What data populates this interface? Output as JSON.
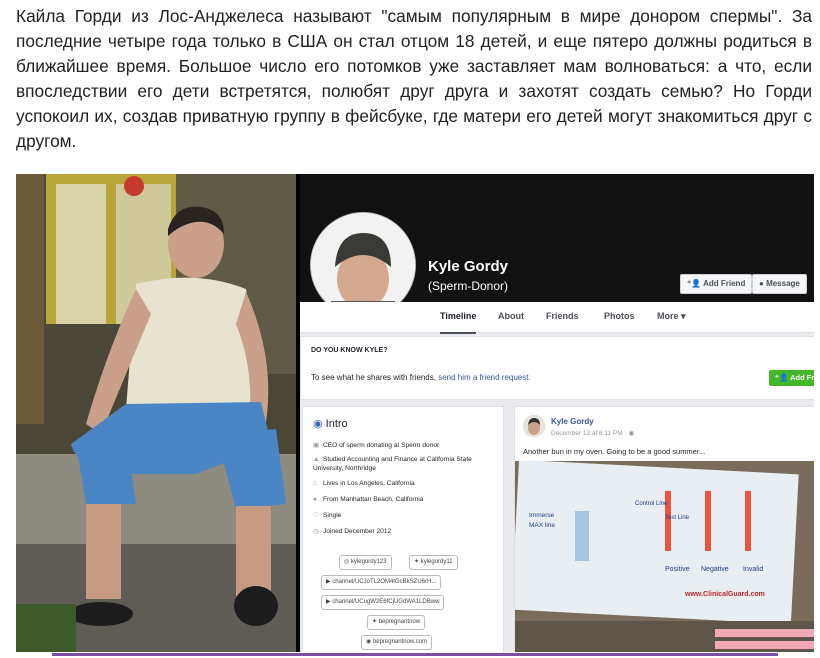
{
  "article": {
    "text": "Кайла Горди из Лос-Анджелеса называют \"самым популярным в мире донором спермы\". За последние четыре года только в США он стал отцом 18 детей, и еще пятеро должны родиться в ближайшее время. Большое число его потомков уже заставляет мам волноваться: а что, если впоследствии его дети встретятся, полюбят друг друга и захотят создать семью? Но Горди успокоил их, создав приватную группу в фейсбуке, где матери его детей могут знакомиться друг с другом."
  },
  "facebook": {
    "profile_name": "Kyle Gordy",
    "profile_subtitle": "(Sperm-Donor)",
    "buttons": {
      "add_friend": "Add Friend",
      "message": "Message",
      "add_friend_green": "Add Frie"
    },
    "nav": [
      "Timeline",
      "About",
      "Friends",
      "Photos",
      "More ▾"
    ],
    "know": {
      "title": "DO YOU KNOW KYLE?",
      "text": "To see what he shares with friends, ",
      "link": "send him a friend request."
    },
    "intro": {
      "title": "Intro",
      "rows": [
        "CEO of sperm donating at Sperm donor",
        "Studied Accounting and Finance at California State University, Northridge",
        "Lives in Los Angeles, California",
        "From Manhattan Beach, California",
        "Single",
        "Joined December 2012"
      ],
      "links": [
        "kylegordy123",
        "kylegordy11",
        "channel/UCJoTL2OM4tGcBkSZU6rH...",
        "channel/UCugW2E6fCjUGdWA1LDBww",
        "bepregnantnow",
        "bepregnantnow.com"
      ]
    },
    "post": {
      "name": "Kyle Gordy",
      "date": "December 13 at 6:11 PM · ",
      "text": "Another bun in my oven. Going to be a good summer...",
      "image_labels": [
        "Positive",
        "Negative",
        "Invalid",
        "www.ClinicalGuard.com",
        "Control Line",
        "Test Line",
        "Immerse",
        "MAX line"
      ]
    }
  },
  "colors": {
    "fb_blue": "#365899",
    "fb_green": "#42b72a",
    "accent_bar": "#7a4fa5"
  }
}
